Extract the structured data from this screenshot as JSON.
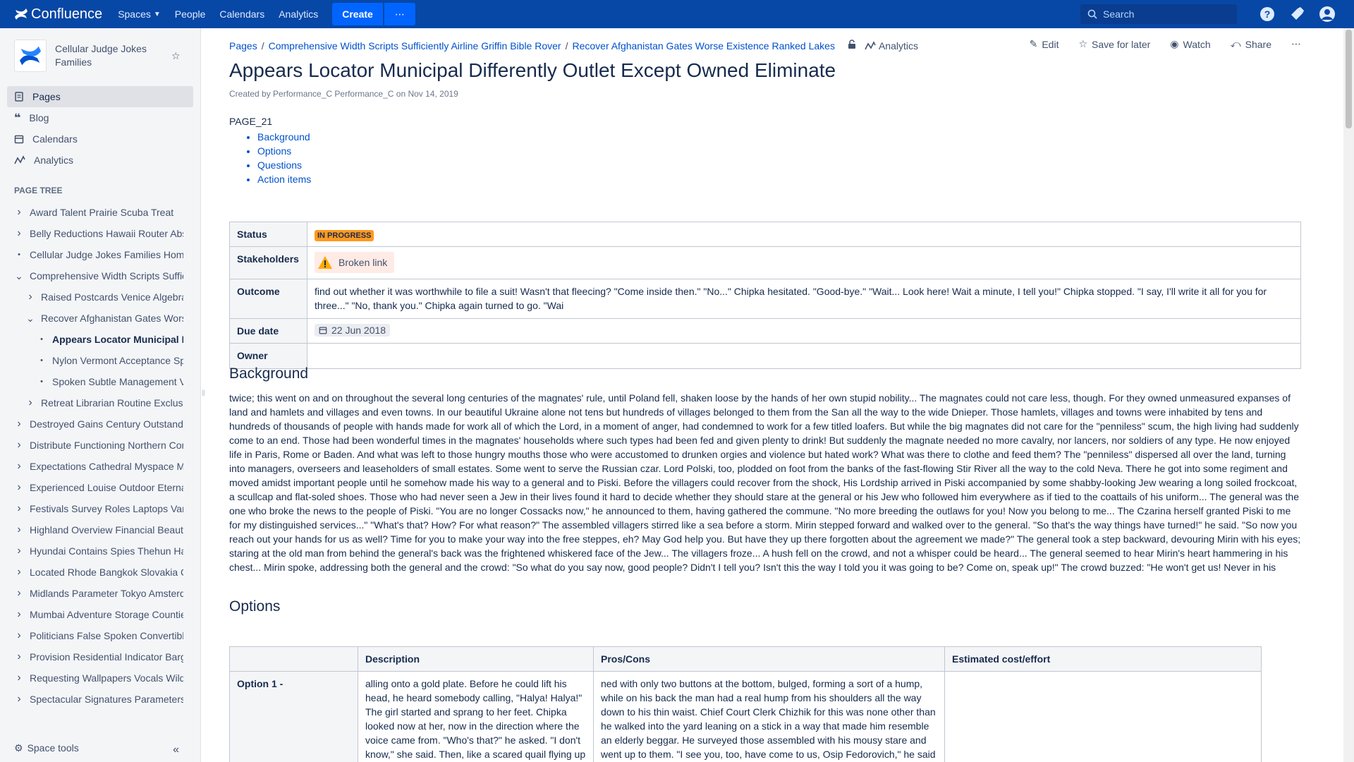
{
  "topnav": {
    "brand": "Confluence",
    "items": [
      "Spaces",
      "People",
      "Calendars",
      "Analytics"
    ],
    "create_label": "Create",
    "search_placeholder": "Search"
  },
  "sidebar": {
    "space_name": "Cellular Judge Jokes Families",
    "nav": [
      {
        "label": "Pages",
        "icon": "page-icon"
      },
      {
        "label": "Blog",
        "icon": "quote-icon"
      },
      {
        "label": "Calendars",
        "icon": "calendar-icon"
      },
      {
        "label": "Analytics",
        "icon": "analytics-icon"
      }
    ],
    "page_tree_title": "PAGE TREE",
    "tree": [
      {
        "label": "Award Talent Prairie Scuba Treat"
      },
      {
        "label": "Belly Reductions Hawaii Router Abs"
      },
      {
        "label": "Cellular Judge Jokes Families Home"
      },
      {
        "label": "Comprehensive Width Scripts Suffic"
      },
      {
        "label": "Raised Postcards Venice Algebra"
      },
      {
        "label": "Recover Afghanistan Gates Worse"
      },
      {
        "label": "Appears Locator Municipal Di"
      },
      {
        "label": "Nylon Vermont Acceptance Spo"
      },
      {
        "label": "Spoken Subtle Management Vit"
      },
      {
        "label": "Retreat Librarian Routine Exclusiv"
      },
      {
        "label": "Destroyed Gains Century Outstandi"
      },
      {
        "label": "Distribute Functioning Northern Con"
      },
      {
        "label": "Expectations Cathedral Myspace Me"
      },
      {
        "label": "Experienced Louise Outdoor Eterna"
      },
      {
        "label": "Festivals Survey Roles Laptops Vari"
      },
      {
        "label": "Highland Overview Financial Beauty"
      },
      {
        "label": "Hyundai Contains Spies Thehun Ha"
      },
      {
        "label": "Located Rhode Bangkok Slovakia C"
      },
      {
        "label": "Midlands Parameter Tokyo Amsterd"
      },
      {
        "label": "Mumbai Adventure Storage Countie"
      },
      {
        "label": "Politicians False Spoken Convertible"
      },
      {
        "label": "Provision Residential Indicator Barg"
      },
      {
        "label": "Requesting Wallpapers Vocals Wild"
      },
      {
        "label": "Spectacular Signatures Parameters"
      }
    ],
    "space_tools": "Space tools"
  },
  "breadcrumbs": [
    "Pages",
    "Comprehensive Width Scripts Sufficiently Airline Griffin Bible Rover",
    "Recover Afghanistan Gates Worse Existence Ranked Lakes"
  ],
  "breadcrumb_analytics": "Analytics",
  "actions": {
    "edit": "Edit",
    "save": "Save for later",
    "watch": "Watch",
    "share": "Share"
  },
  "page": {
    "title": "Appears Locator Municipal Differently Outlet Except Owned Eliminate",
    "byline": "Created by Performance_C Performance_C on Nov 14, 2019",
    "code": "PAGE_21",
    "toc": [
      "Background",
      "Options",
      "Questions",
      "Action items"
    ]
  },
  "status_table": {
    "status_label": "Status",
    "status_value": "IN PROGRESS",
    "stakeholders_label": "Stakeholders",
    "stakeholders_value": "Broken link",
    "outcome_label": "Outcome",
    "outcome_value": "find out whether it was worthwhile to file a suit! Wasn't that fleecing? \"Come inside then.\" \"No...\" Chipka hesitated. \"Good-bye.\" \"Wait... Look here! Wait a minute, I tell you!\" Chipka stopped. \"I say, I'll write it all for you for three...\" \"No, thank you.\" Chipka again turned to go. \"Wai",
    "due_label": "Due date",
    "due_value": "22 Jun 2018",
    "owner_label": "Owner",
    "owner_value": ""
  },
  "background": {
    "heading": "Background",
    "text": "twice; this went on and on throughout the several long centuries of the magnates' rule, until Poland fell, shaken loose by the hands of her own stupid nobility... The magnates could not care less, though. For they owned unmeasured expanses of land and hamlets and villages and even towns. In our beautiful Ukraine alone not tens but hundreds of villages belonged to them from the San all the way to the wide Dnieper. Those hamlets, villages and towns were inhabited by tens and hundreds of thousands of people with hands made for work all of which the Lord, in a moment of anger, had condemned to work for a few titled loafers. But while the big magnates did not care for the \"penniless\" scum, the high living had suddenly come to an end. Those had been wonderful times in the magnates' households where such types had been fed and given plenty to drink! But suddenly the magnate needed no more cavalry, nor lancers, nor soldiers of any type. He now enjoyed life in Paris, Rome or Baden. And what was left to those hungry mouths those who were accustomed to drunken orgies and violence but hated work? What was there to clothe and feed them? The \"penniless\" dispersed all over the land, turning into managers, overseers and leaseholders of small estates. Some went to serve the Russian czar. Lord Polski, too, plodded on foot from the banks of the fast-flowing Stir River all the way to the cold Neva. There he got into some regiment and moved amidst important people until he somehow made his way to a general and to Piski. Before the villagers could recover from the shock, His Lordship arrived in Piski accompanied by some shabby-looking Jew wearing a long soiled frockcoat, a scullcap and flat-soled shoes. Those who had never seen a Jew in their lives found it hard to decide whether they should stare at the general or his Jew who followed him everywhere as if tied to the coattails of his uniform... The general was the one who broke the news to the people of Piski. \"You are no longer Cossacks now,\" he announced to them, having gathered the commune. \"No more breeding the outlaws for you! Now you belong to me... The Czarina herself granted Piski to me for my distinguished services...\" \"What's that? How? For what reason?\" The assembled villagers stirred like a sea before a storm. Mirin stepped forward and walked over to the general. \"So that's the way things have turned!\" he said. \"So now you reach out your hands for us as well? Time for you to make your way into the free steppes, eh? May God help you. But have they up there forgotten about the agreement we made?\" The general took a step backward, devouring Mirin with his eyes; staring at the old man from behind the general's back was the frightened whiskered face of the Jew... The villagers froze... A hush fell on the crowd, and not a whisper could be heard... The general seemed to hear Mirin's heart hammering in his chest... Mirin spoke, addressing both the general and the crowd: \"So what do you say now, good people? Didn't I tell you? Isn't this the way I told you it was going to be? Come on, speak up!\" The crowd buzzed: \"He won't get us! Never in his"
  },
  "options": {
    "heading": "Options",
    "headers": [
      "",
      "Description",
      "Pros/Cons",
      "Estimated cost/effort"
    ],
    "row_label": "Option 1 -",
    "description": "alling onto a gold plate. Before he could lift his head, he heard somebody calling, \"Halya! Halya!\" The girl started and sprang to her feet. Chipka looked now at her, now in the direction where the voice came from. \"Who's that?\" he asked. \"I don't know,\" she said. Then, like a scared quail flying up",
    "pros_cons": "ned with only two buttons at the bottom, bulged, forming a sort of a hump, while on his back the man had a real hump from his shoulders all the way down to his thin waist. Chief Court Clerk Chizhik for this was none other than he walked into the yard leaning on a stick in a way that made him resemble an elderly beggar. He surveyed those assembled with his mousy stare and went up to them. \"I see you, too, have come to us, Osip Fedorovich,\" he said",
    "cost": ""
  }
}
